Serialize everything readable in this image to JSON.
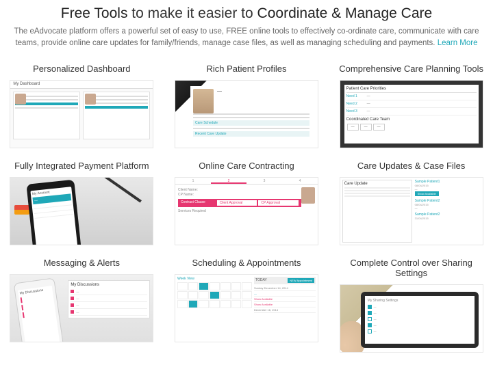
{
  "hero": {
    "title_pre": "Free Tools",
    "title_mid": " to make it easier to ",
    "title_post": "Coordinate & Manage Care",
    "description": "The eAdvocate platform offers a powerful set of easy to use, FREE online tools to effectively co-ordinate care, communicate with care teams, provide online care updates for family/friends, manage case files, as well as managing scheduling and payments. ",
    "learn_more": "Learn More"
  },
  "cards": {
    "c1": "Personalized Dashboard",
    "c2": "Rich Patient Profiles",
    "c3": "Comprehensive Care Planning Tools",
    "c4": "Fully Integrated Payment Platform",
    "c5": "Online Care Contracting",
    "c6": "Care Updates & Case Files",
    "c7": "Messaging & Alerts",
    "c8": "Scheduling & Appointments",
    "c9": "Complete Control over Sharing Settings"
  },
  "t1": {
    "dash": "My Dashboard"
  },
  "t2": {
    "sec1": "Care Schedule",
    "sec2": "Recent Care Update"
  },
  "t3": {
    "title": "Patient Care Priorities",
    "n1": "Need 1",
    "n2": "Need 2",
    "n3": "Need 3",
    "coord": "Coordinated Care Team"
  },
  "t4": {
    "acct": "My Account"
  },
  "t5": {
    "cname": "Client Name:",
    "cpname": "CP Name:",
    "clause": "Contract Clause",
    "ca": "Client Approval",
    "cp": "CP Approval",
    "svc": "Services Required"
  },
  "t6": {
    "title": "Care Update",
    "p1": "Sample Patient1",
    "p2": "Sample Patient2",
    "d1": "08/04/2015",
    "d2": "31/04/2015",
    "btn": "Show Available"
  },
  "t7": {
    "title": "My Discussions"
  },
  "t8": {
    "week": "Week View",
    "new": "NEW Appointment",
    "today": "TODAY",
    "date": "Sunday December 14, 2014",
    "show": "Show Available",
    "d2": "December 16, 2014"
  },
  "t9": {
    "title": "My Sharing Settings"
  }
}
